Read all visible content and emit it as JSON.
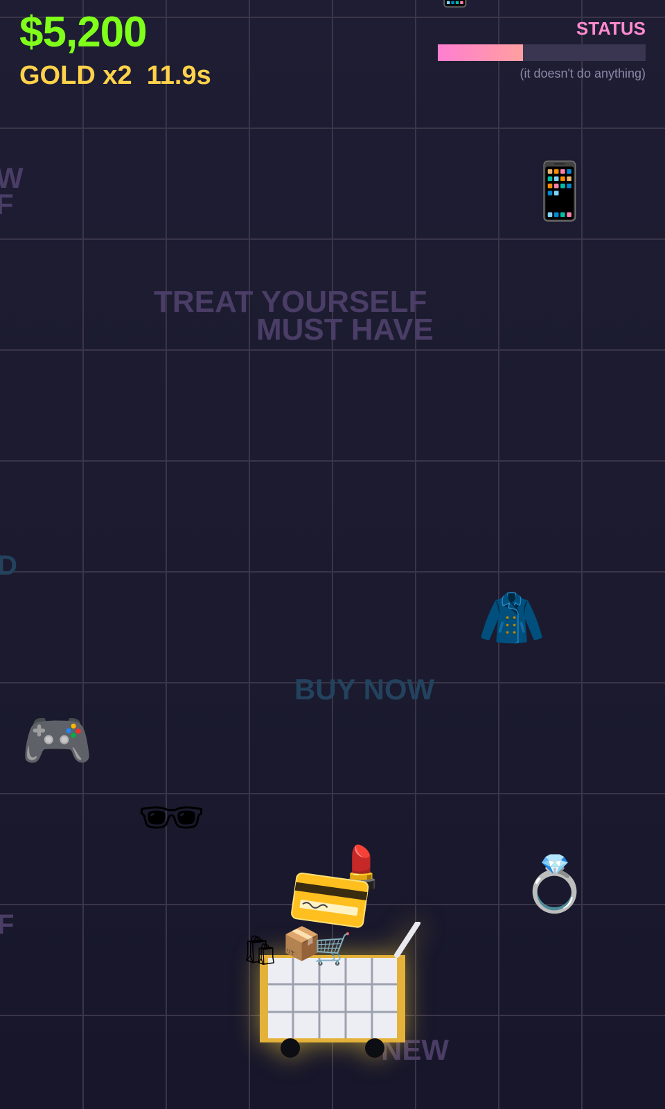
{
  "hud": {
    "money": "$5,200",
    "multiplier": "GOLD x2  11.9s",
    "status_label": "STATUS",
    "status_note": "(it doesn't do anything)",
    "status_progress": 0.41,
    "colors": {
      "money": "#7fff1a",
      "multiplier": "#ffd24a",
      "status": "#ff8ad0"
    }
  },
  "background_slogans": {
    "treat_yourself": "TREAT YOURSELF",
    "must_have": "MUST HAVE",
    "buy_now": "BUY NOW",
    "new": "NEW",
    "edge_w": "W",
    "edge_f": "F",
    "edge_d": "D",
    "edge_f2": "F"
  },
  "falling_items": [
    {
      "name": "smartphone",
      "glyph": "📱"
    },
    {
      "name": "coat",
      "glyph": "🧥"
    },
    {
      "name": "game-controller",
      "glyph": "🎮"
    },
    {
      "name": "sunglasses",
      "glyph": "🕶"
    },
    {
      "name": "ring",
      "glyph": "💍"
    },
    {
      "name": "lipstick",
      "glyph": "💄"
    }
  ],
  "cart": {
    "items": [
      {
        "name": "shopping-bags",
        "glyph": "🛍"
      },
      {
        "name": "package",
        "glyph": "📦"
      },
      {
        "name": "mini-cart",
        "glyph": "🛒"
      }
    ]
  }
}
